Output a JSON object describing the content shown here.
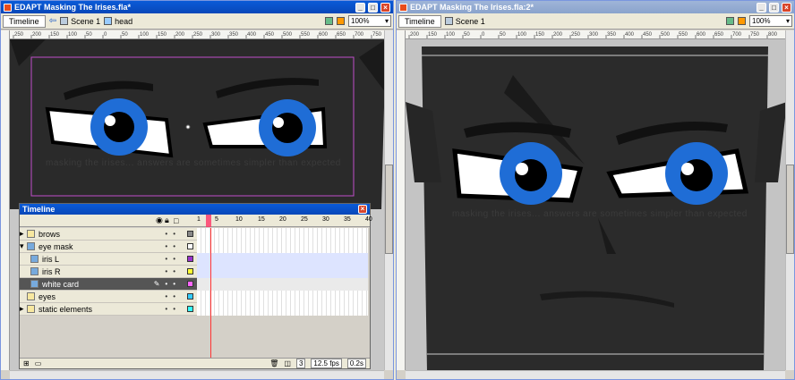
{
  "left": {
    "title": "EDAPT Masking The Irises.fla*",
    "tab": "Timeline",
    "crumbs": [
      "Scene 1",
      "head"
    ],
    "zoom": "100%",
    "ruler_ticks": [
      "250",
      "200",
      "150",
      "100",
      "50",
      "0",
      "50",
      "100",
      "150",
      "200",
      "250",
      "300",
      "350",
      "400",
      "450",
      "500",
      "550",
      "600",
      "650",
      "700",
      "750"
    ],
    "watermark": "masking the irises... answers are sometimes simpler than expected"
  },
  "right": {
    "title": "EDAPT Masking The Irises.fla:2*",
    "tab": "Timeline",
    "crumbs": [
      "Scene 1"
    ],
    "zoom": "100%",
    "ruler_ticks": [
      "200",
      "150",
      "100",
      "50",
      "0",
      "50",
      "100",
      "150",
      "200",
      "250",
      "300",
      "350",
      "400",
      "450",
      "500",
      "550",
      "600",
      "650",
      "700",
      "750",
      "800"
    ],
    "watermark": "masking the irises... answers are sometimes simpler than expected"
  },
  "timeline": {
    "title": "Timeline",
    "frame_numbers": [
      "1",
      "5",
      "10",
      "15",
      "20",
      "25",
      "30",
      "35",
      "40"
    ],
    "layers": [
      {
        "name": "brows",
        "color": "#888888"
      },
      {
        "name": "eye mask",
        "color": "#ffffff"
      },
      {
        "name": "iris L",
        "color": "#9933cc"
      },
      {
        "name": "iris R",
        "color": "#ffff33"
      },
      {
        "name": "white card",
        "color": "#ff66ff"
      },
      {
        "name": "eyes",
        "color": "#33ccff"
      },
      {
        "name": "static elements",
        "color": "#33ffff"
      }
    ],
    "current_frame": "3",
    "fps": "12.5 fps",
    "time": "0.2s"
  }
}
